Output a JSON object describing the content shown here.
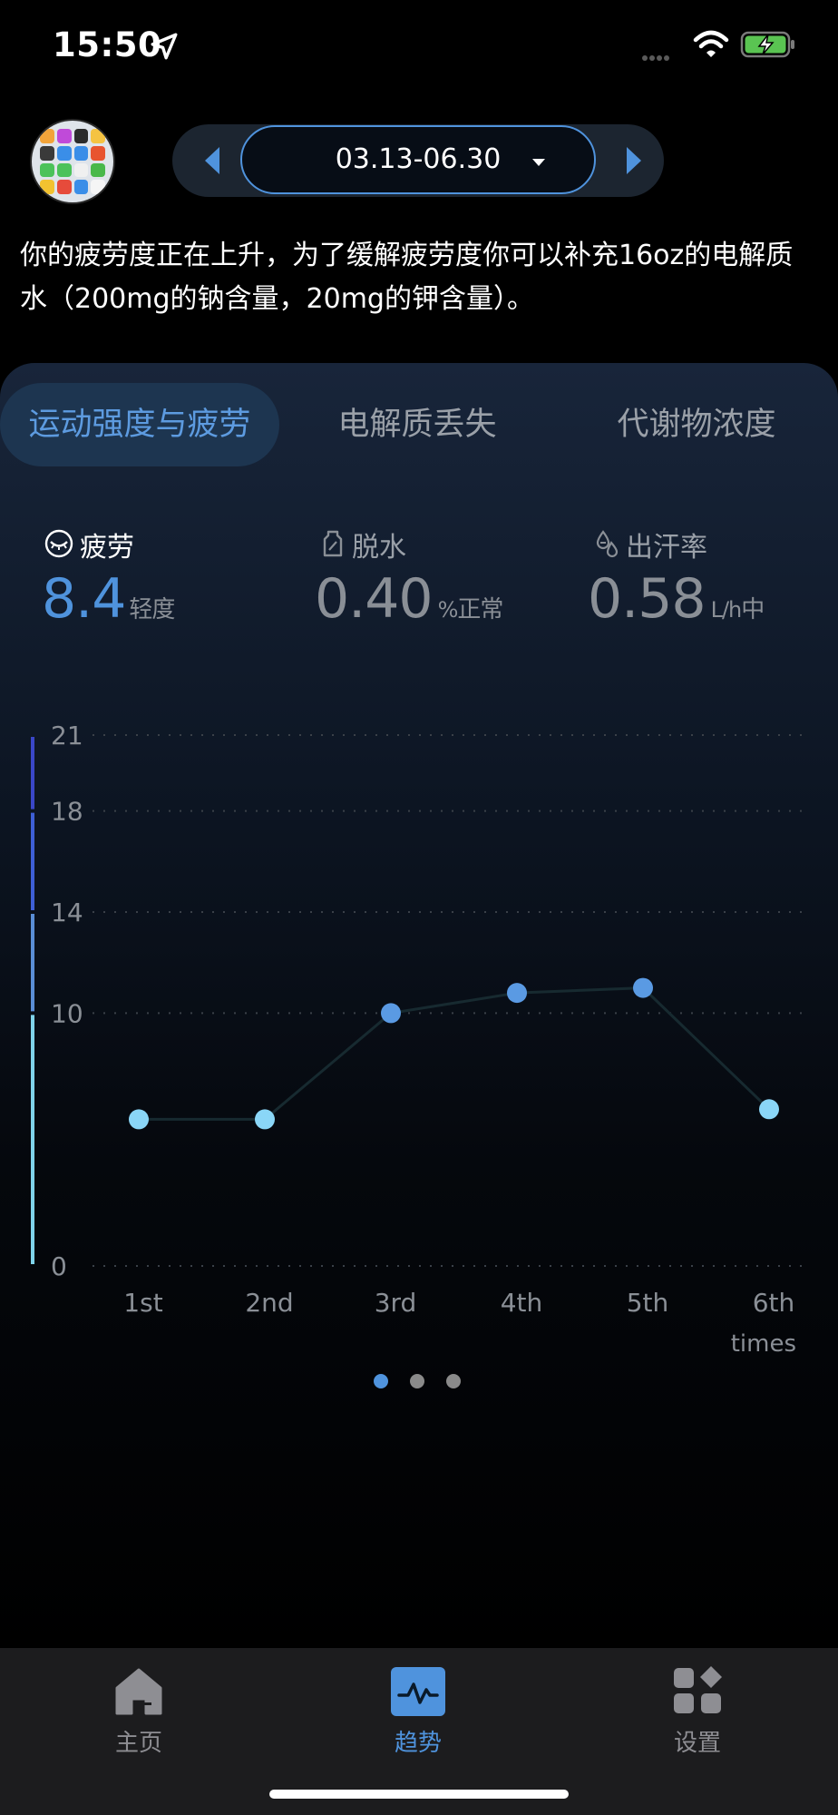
{
  "status_bar": {
    "time": "15:50"
  },
  "header": {
    "date_range": "03.13-06.30",
    "advice": "你的疲劳度正在上升，为了缓解疲劳度你可以补充16oz的电解质水（200mg的钠含量，20mg的钾含量）。"
  },
  "tabs": [
    {
      "label": "运动强度与疲劳",
      "active": true
    },
    {
      "label": "电解质丢失",
      "active": false
    },
    {
      "label": "代谢物浓度",
      "active": false
    }
  ],
  "metrics": {
    "fatigue": {
      "label": "疲劳",
      "value": "8.4",
      "status": "轻度",
      "icon": "closed-eye-icon",
      "color": "#4f93dd"
    },
    "dehydration": {
      "label": "脱水",
      "value": "0.40",
      "unit": "%",
      "status": "正常",
      "icon": "bottle-icon"
    },
    "sweat_rate": {
      "label": "出汗率",
      "value": "0.58",
      "unit": "L/h",
      "status": "中",
      "icon": "drops-icon"
    }
  },
  "chart_data": {
    "type": "line",
    "categories": [
      "1st",
      "2nd",
      "3rd",
      "4th",
      "5th",
      "6th"
    ],
    "values": [
      5.8,
      5.8,
      10.0,
      10.8,
      11.0,
      6.2
    ],
    "y_ticks": [
      0,
      10,
      14,
      18,
      21
    ],
    "ylim": [
      0,
      21
    ],
    "xlabel": "times",
    "grid": true,
    "zone_colors": [
      "#7fd3ea",
      "#5a8ed6",
      "#3e5fd6",
      "#3a47c8"
    ],
    "point_color_low": "#8ad6f7",
    "point_color_high": "#5a9ae3"
  },
  "pager": {
    "pages": 3,
    "active": 0
  },
  "bottom_nav": {
    "home": "主页",
    "trend": "趋势",
    "settings": "设置"
  }
}
